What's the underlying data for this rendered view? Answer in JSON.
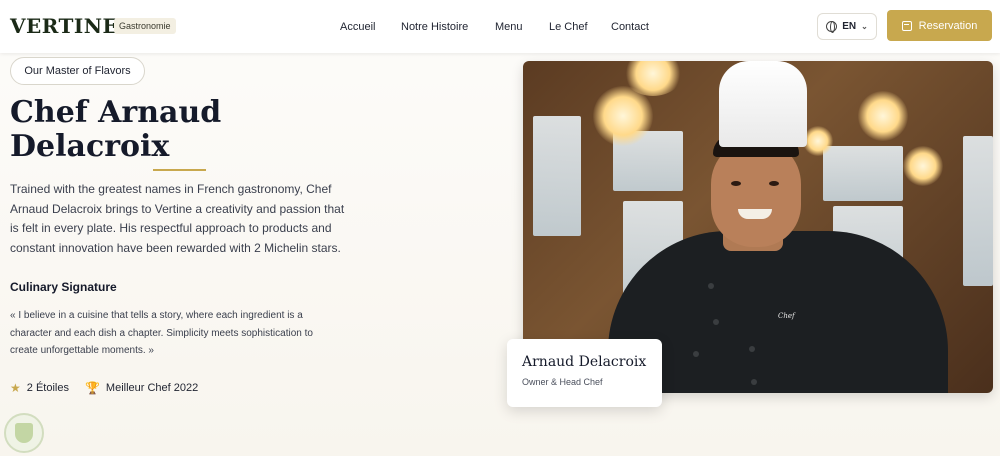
{
  "header": {
    "logo": "VERTINE",
    "logo_badge": "Gastronomie",
    "nav": [
      {
        "label": "Accueil"
      },
      {
        "label": "Notre Histoire"
      },
      {
        "label": "Menu"
      },
      {
        "label": "Le Chef"
      },
      {
        "label": "Contact"
      }
    ],
    "language": "EN",
    "reservation_label": "Reservation"
  },
  "hero": {
    "pill_label": "Our Master of Flavors",
    "title_line1": "Chef Arnaud",
    "title_line2": "Delacroix",
    "description": "Trained with the greatest names in French gastronomy, Chef Arnaud Delacroix brings to Vertine a creativity and passion that is felt in every plate. His respectful approach to products and constant innovation have been rewarded with 2 Michelin stars.",
    "signature_title": "Culinary Signature",
    "signature_quote": "« I believe in a cuisine that tells a story, where each ingredient is a character and each dish a chapter. Simplicity meets sophistication to create unforgettable moments. »",
    "awards": [
      {
        "icon": "star-icon",
        "label": "2 Étoiles"
      },
      {
        "icon": "trophy-icon",
        "label": "Meilleur Chef 2022"
      }
    ]
  },
  "photo": {
    "alt_icon": "chef-portrait",
    "caption_name": "Arnaud Delacroix",
    "caption_role": "Owner & Head Chef"
  },
  "colors": {
    "accent": "#c8a84e",
    "text_dark": "#151a2a",
    "background": "#fdfcfa"
  }
}
